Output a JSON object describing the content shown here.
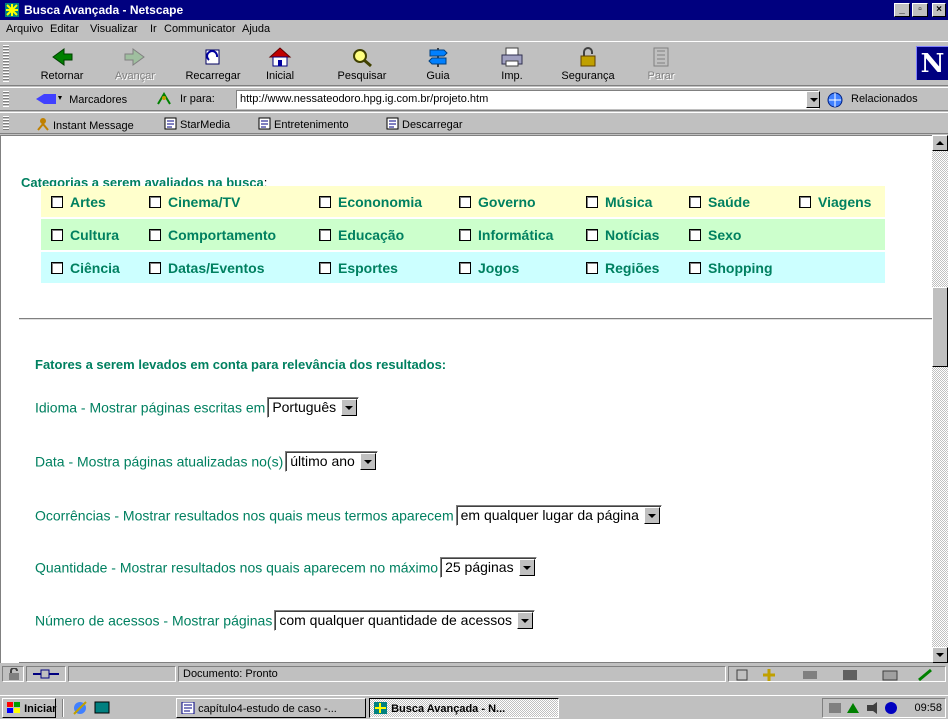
{
  "window": {
    "title": "Busca Avançada - Netscape",
    "controls": [
      "_",
      "▫",
      "×"
    ]
  },
  "menu": [
    "Arquivo",
    "Editar",
    "Visualizar",
    "Ir",
    "Communicator",
    "Ajuda"
  ],
  "toolbar": {
    "back": "Retornar",
    "forward": "Avançar",
    "reload": "Recarregar",
    "home": "Inicial",
    "search": "Pesquisar",
    "guide": "Guia",
    "print": "Imp.",
    "security": "Segurança",
    "stop": "Parar",
    "logo": "N"
  },
  "location": {
    "bookmarks": "Marcadores",
    "goto_label": "Ir para:",
    "url": "http://www.nessateodoro.hpg.ig.com.br/projeto.htm",
    "related": "Relacionados"
  },
  "personal_toolbar": [
    "Instant Message",
    "StarMedia",
    "Entretenimento",
    "Descarregar"
  ],
  "page": {
    "categories_heading": "Categorias a serem avaliados na busca",
    "categories_colon": ":",
    "categories": [
      [
        "Artes",
        "Cinema/TV",
        "Econonomia",
        "Governo",
        "Música",
        "Saúde",
        "Viagens"
      ],
      [
        "Cultura",
        "Comportamento",
        "Educação",
        "Informática",
        "Notícias",
        "Sexo",
        ""
      ],
      [
        "Ciência",
        "Datas/Eventos",
        "Esportes",
        "Jogos",
        "Regiões",
        "Shopping",
        ""
      ]
    ],
    "factors_heading": "Fatores a serem levados em conta para relevância dos resultados:",
    "factors": [
      {
        "label": "Idioma - Mostrar páginas escritas em",
        "value": "Português"
      },
      {
        "label": "Data - Mostra páginas atualizadas no(s)",
        "value": "último ano"
      },
      {
        "label": "Ocorrências - Mostrar resultados nos quais meus termos aparecem",
        "value": "em qualquer lugar da página"
      },
      {
        "label": "Quantidade - Mostrar resultados nos quais aparecem no máximo",
        "value": "25 páginas"
      },
      {
        "label": "Número de acessos - Mostrar páginas",
        "value": "com qualquer quantidade de acessos"
      }
    ]
  },
  "status": {
    "text": "Documento: Pronto"
  },
  "taskbar": {
    "start": "Iniciar",
    "tasks": [
      "capítulo4-estudo de caso -...",
      "Busca Avançada - N..."
    ],
    "clock": "09:58"
  }
}
